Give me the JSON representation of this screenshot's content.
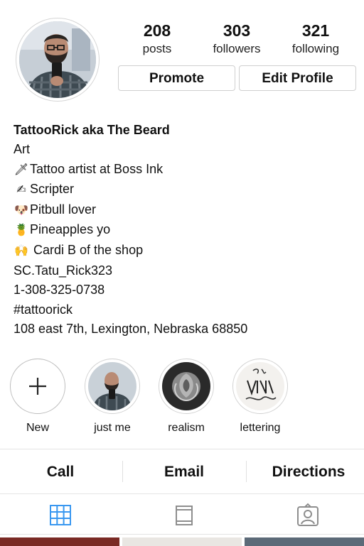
{
  "profile": {
    "stats": [
      {
        "value": "208",
        "label": "posts"
      },
      {
        "value": "303",
        "label": "followers"
      },
      {
        "value": "321",
        "label": "following"
      }
    ],
    "buttons": {
      "promote": "Promote",
      "edit": "Edit Profile"
    }
  },
  "bio": {
    "name": "TattooRick aka The Beard",
    "category": "Art",
    "lines": [
      {
        "icon": "🗡",
        "icon_name": "dagger-icon",
        "text": "Tattoo artist at Boss Ink"
      },
      {
        "icon": "✍",
        "icon_name": "writing-hand-icon",
        "text": "Scripter"
      },
      {
        "icon": "🐶",
        "icon_name": "dog-face-icon",
        "text": "Pitbull lover"
      },
      {
        "icon": "🍍",
        "icon_name": "pineapple-icon",
        "text": "Pineapples yo"
      },
      {
        "icon": "🙌",
        "icon_name": "raised-hands-icon",
        "text": " Cardi B of the shop"
      }
    ],
    "contact_lines": [
      "SC.Tatu_Rick323",
      "1-308-325-0738",
      "#tattoorick",
      "108 east 7th, Lexington, Nebraska 68850"
    ]
  },
  "highlights": [
    {
      "label": "New",
      "icon": "plus-icon"
    },
    {
      "label": "just me"
    },
    {
      "label": "realism"
    },
    {
      "label": "lettering"
    }
  ],
  "actions": {
    "call": "Call",
    "email": "Email",
    "directions": "Directions"
  },
  "tabs": [
    {
      "icon": "grid-icon",
      "active": true
    },
    {
      "icon": "feed-view-icon",
      "active": false
    },
    {
      "icon": "tagged-person-icon",
      "active": false
    }
  ],
  "colors": {
    "accent": "#3897f0",
    "inactive_icon": "#8e8e8e",
    "divider": "#e4e4e4"
  }
}
